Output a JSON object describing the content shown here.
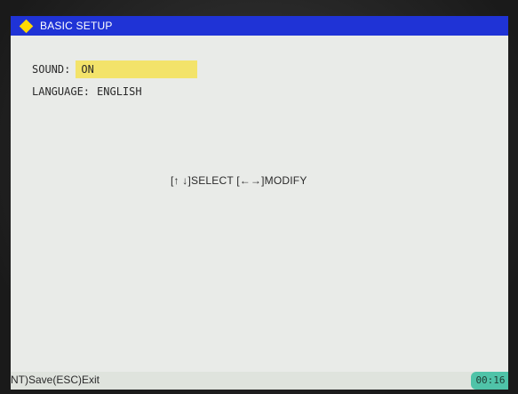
{
  "title_bar": {
    "title": "BASIC SETUP",
    "icon": "diamond-icon",
    "color": "#1f33d6",
    "icon_color": "#ffd900"
  },
  "settings": {
    "sound": {
      "label": "SOUND:",
      "value": "ON",
      "highlight_color": "#f3e36a"
    },
    "language": {
      "label": "LANGUAGE:",
      "value": "ENGLISH"
    }
  },
  "hint": "[↑ ↓]SELECT [←→]MODIFY",
  "status_bar": {
    "left_text": "(ENT)Save(ESC)Exit",
    "clock": "00:16",
    "clock_color": "#4fc3a8"
  }
}
